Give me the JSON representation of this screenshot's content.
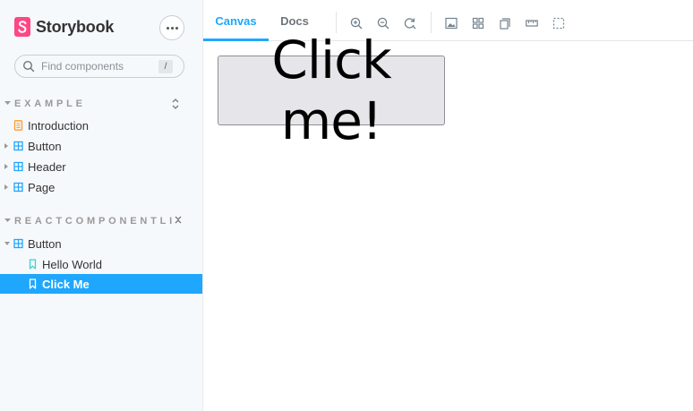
{
  "app": {
    "brand_name": "Storybook",
    "brand_color": "#ff4785",
    "accent_color": "#1ea7fd"
  },
  "sidebar": {
    "menu_icon": "ellipsis-icon",
    "search": {
      "placeholder": "Find components",
      "shortcut": "/"
    },
    "groups": [
      {
        "title": "EXAMPLE",
        "toggle_icon": "expand-collapse-icon",
        "items": [
          {
            "label": "Introduction",
            "icon": "document-icon",
            "expandable": false
          },
          {
            "label": "Button",
            "icon": "component-icon",
            "expandable": true
          },
          {
            "label": "Header",
            "icon": "component-icon",
            "expandable": true
          },
          {
            "label": "Page",
            "icon": "component-icon",
            "expandable": true
          }
        ]
      },
      {
        "title": "REACTCOMPONENTLIB",
        "toggle_icon": "collapse-icon",
        "items": [
          {
            "label": "Button",
            "icon": "component-icon",
            "expanded": true
          },
          {
            "label": "Hello World",
            "icon": "bookmark-icon",
            "selected": false
          },
          {
            "label": "Click Me",
            "icon": "bookmark-icon",
            "selected": true
          }
        ]
      }
    ]
  },
  "toolbar": {
    "tabs": [
      {
        "label": "Canvas",
        "active": true
      },
      {
        "label": "Docs",
        "active": false
      }
    ],
    "tools": [
      "zoom-in-icon",
      "zoom-out-icon",
      "zoom-reset-icon",
      "background-icon",
      "grid-icon",
      "viewport-icon",
      "measure-icon",
      "outline-icon"
    ]
  },
  "canvas": {
    "button_label": "Click me!"
  }
}
